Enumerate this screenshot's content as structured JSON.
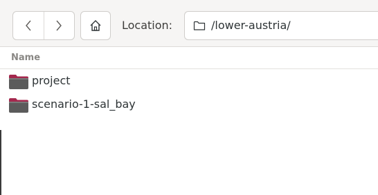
{
  "toolbar": {
    "back_icon": "chevron-left-icon",
    "forward_icon": "chevron-right-icon",
    "home_icon": "home-icon",
    "location_label": "Location:",
    "location_icon": "folder-outline-icon",
    "location_value": "/lower-austria/"
  },
  "list": {
    "column_name": "Name",
    "items": [
      {
        "name": "project",
        "icon": "folder-icon"
      },
      {
        "name": "scenario-1-sal_bay",
        "icon": "folder-icon"
      }
    ]
  },
  "colors": {
    "folder_tab": "#a4284d",
    "folder_body": "#5b5b5b",
    "toolbar_bg": "#f6f5f4"
  }
}
